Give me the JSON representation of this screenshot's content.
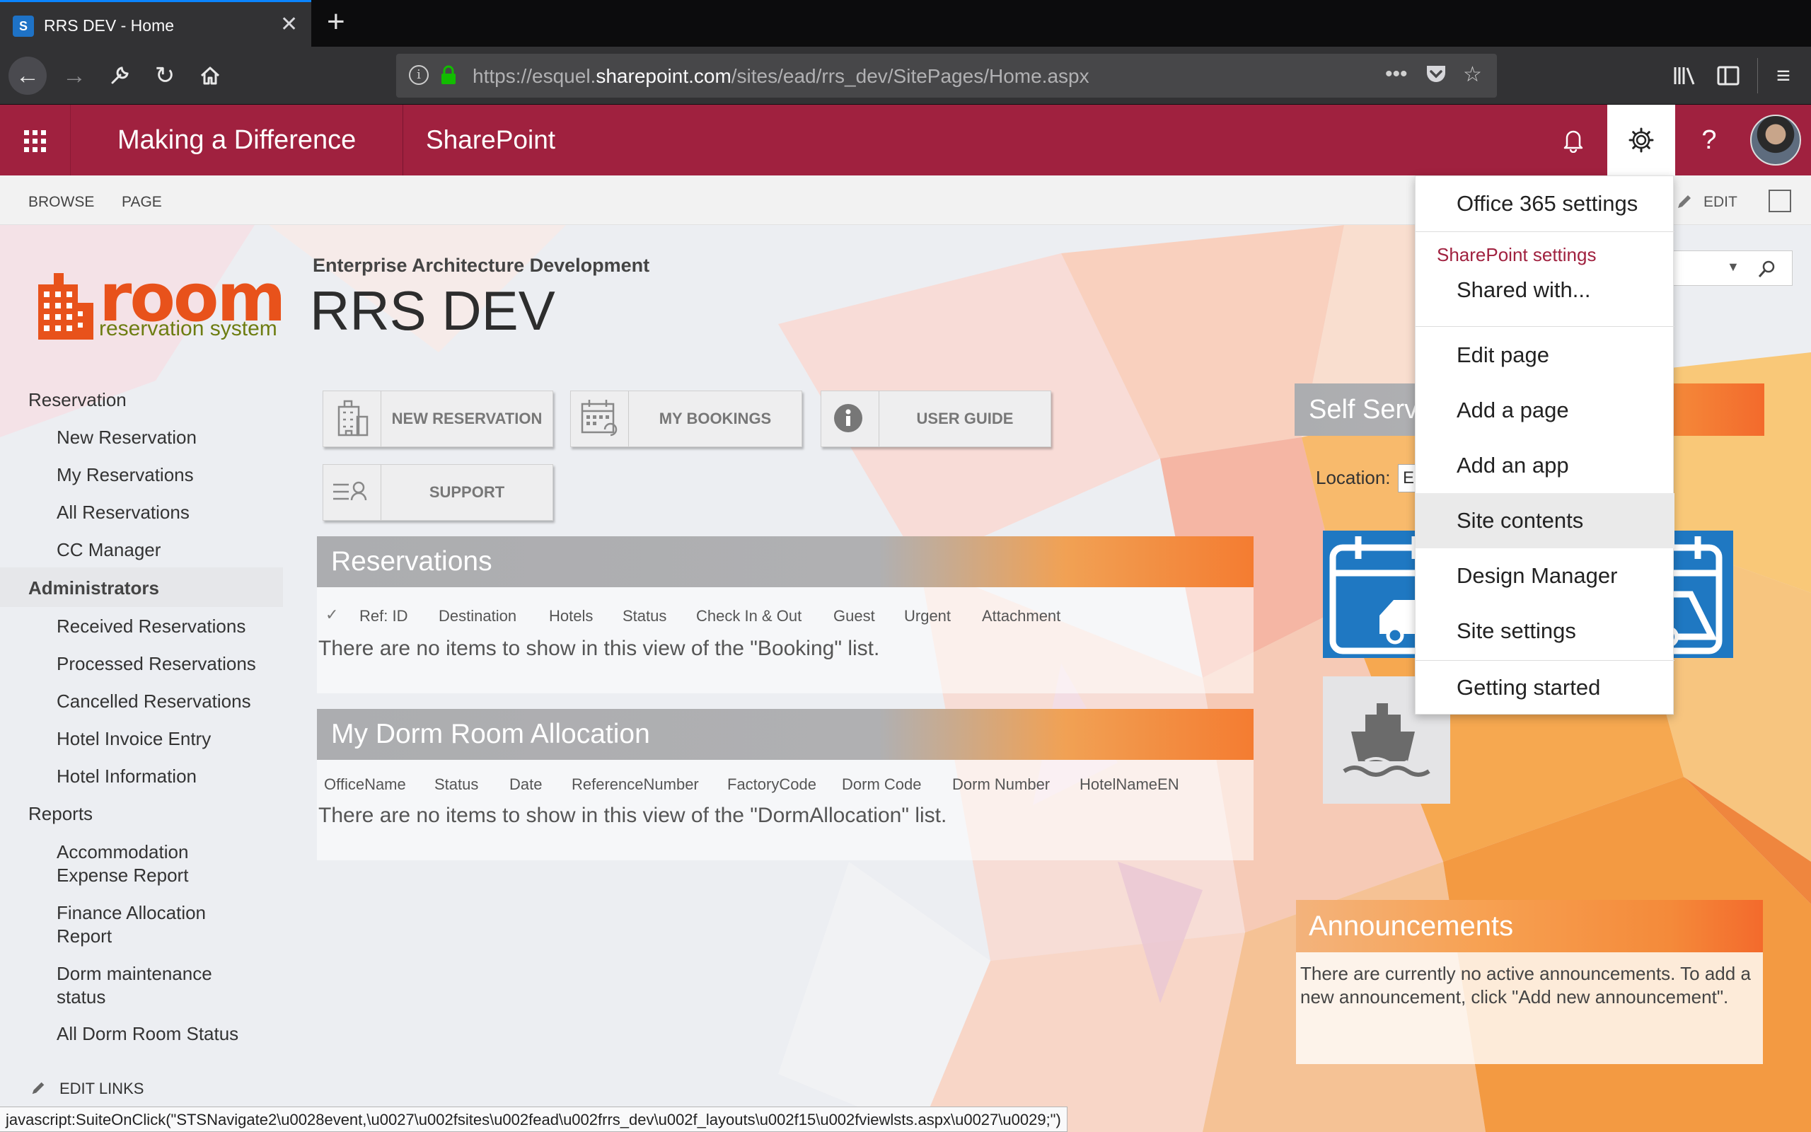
{
  "browser": {
    "tab_title": "RRS DEV - Home",
    "favicon_letter": "S",
    "url_prefix": "https://esquel.",
    "url_domain": "sharepoint.com",
    "url_path": "/sites/ead/rrs_dev/SitePages/Home.aspx",
    "status_text": "javascript:SuiteOnClick(\"STSNavigate2\\u0028event,\\u0027\\u002fsites\\u002fead\\u002frrs_dev\\u002f_layouts\\u002f15\\u002fviewlsts.aspx\\u0027\\u0029;\")"
  },
  "suite": {
    "brand": "Making a Difference",
    "app_name": "SharePoint"
  },
  "ribbon": {
    "browse": "BROWSE",
    "page": "PAGE",
    "edit": "EDIT"
  },
  "header": {
    "logo_main": "room",
    "logo_sub": "reservation system",
    "subtitle": "Enterprise Architecture Development",
    "title": "RRS DEV"
  },
  "leftnav": {
    "reservation": "Reservation",
    "new_reservation": "New Reservation",
    "my_reservations": "My Reservations",
    "all_reservations": "All Reservations",
    "cc_manager": "CC Manager",
    "administrators": "Administrators",
    "received_reservations": "Received Reservations",
    "processed_reservations": "Processed Reservations",
    "cancelled_reservations": "Cancelled Reservations",
    "hotel_invoice_entry": "Hotel Invoice Entry",
    "hotel_information": "Hotel Information",
    "reports": "Reports",
    "accommodation_1": "Accommodation",
    "accommodation_2": "Expense Report",
    "finance_1": "Finance Allocation",
    "finance_2": "Report",
    "dorm_1": "Dorm maintenance",
    "dorm_2": "status",
    "all_dorm": "All Dorm Room Status",
    "edit_links": "EDIT LINKS"
  },
  "tiles": {
    "new_reservation": "NEW RESERVATION",
    "my_bookings": "MY BOOKINGS",
    "user_guide": "USER GUIDE",
    "support": "SUPPORT"
  },
  "reservations": {
    "title": "Reservations",
    "columns": [
      "Ref: ID",
      "Destination",
      "Hotels",
      "Status",
      "Check In & Out",
      "Guest",
      "Urgent",
      "Attachment"
    ],
    "empty": "There are no items to show in this view of the \"Booking\" list."
  },
  "dorm": {
    "title": "My Dorm Room Allocation",
    "columns": [
      "OfficeName",
      "Status",
      "Date",
      "ReferenceNumber",
      "FactoryCode",
      "Dorm Code",
      "Dorm Number",
      "HotelNameEN"
    ],
    "empty": "There are no items to show in this view of the \"DormAllocation\" list."
  },
  "selfservice": {
    "title": "Self Serv",
    "location_label": "Location:",
    "location_value": "E"
  },
  "announcements": {
    "title": "Announcements",
    "line1": "There are currently no active announcements. To add a",
    "line2": "new announcement, click \"Add new announcement\"."
  },
  "settings_menu": {
    "office365": "Office 365 settings",
    "sp_section": "SharePoint settings",
    "shared_with": "Shared with...",
    "edit_page": "Edit page",
    "add_page": "Add a page",
    "add_app": "Add an app",
    "site_contents": "Site contents",
    "design_manager": "Design Manager",
    "site_settings": "Site settings",
    "getting_started": "Getting started"
  },
  "colors": {
    "suite_bar": "#a0213f",
    "accent_orange": "#f47c31",
    "logo_orange": "#e8521b",
    "logo_green": "#6d7d12"
  }
}
